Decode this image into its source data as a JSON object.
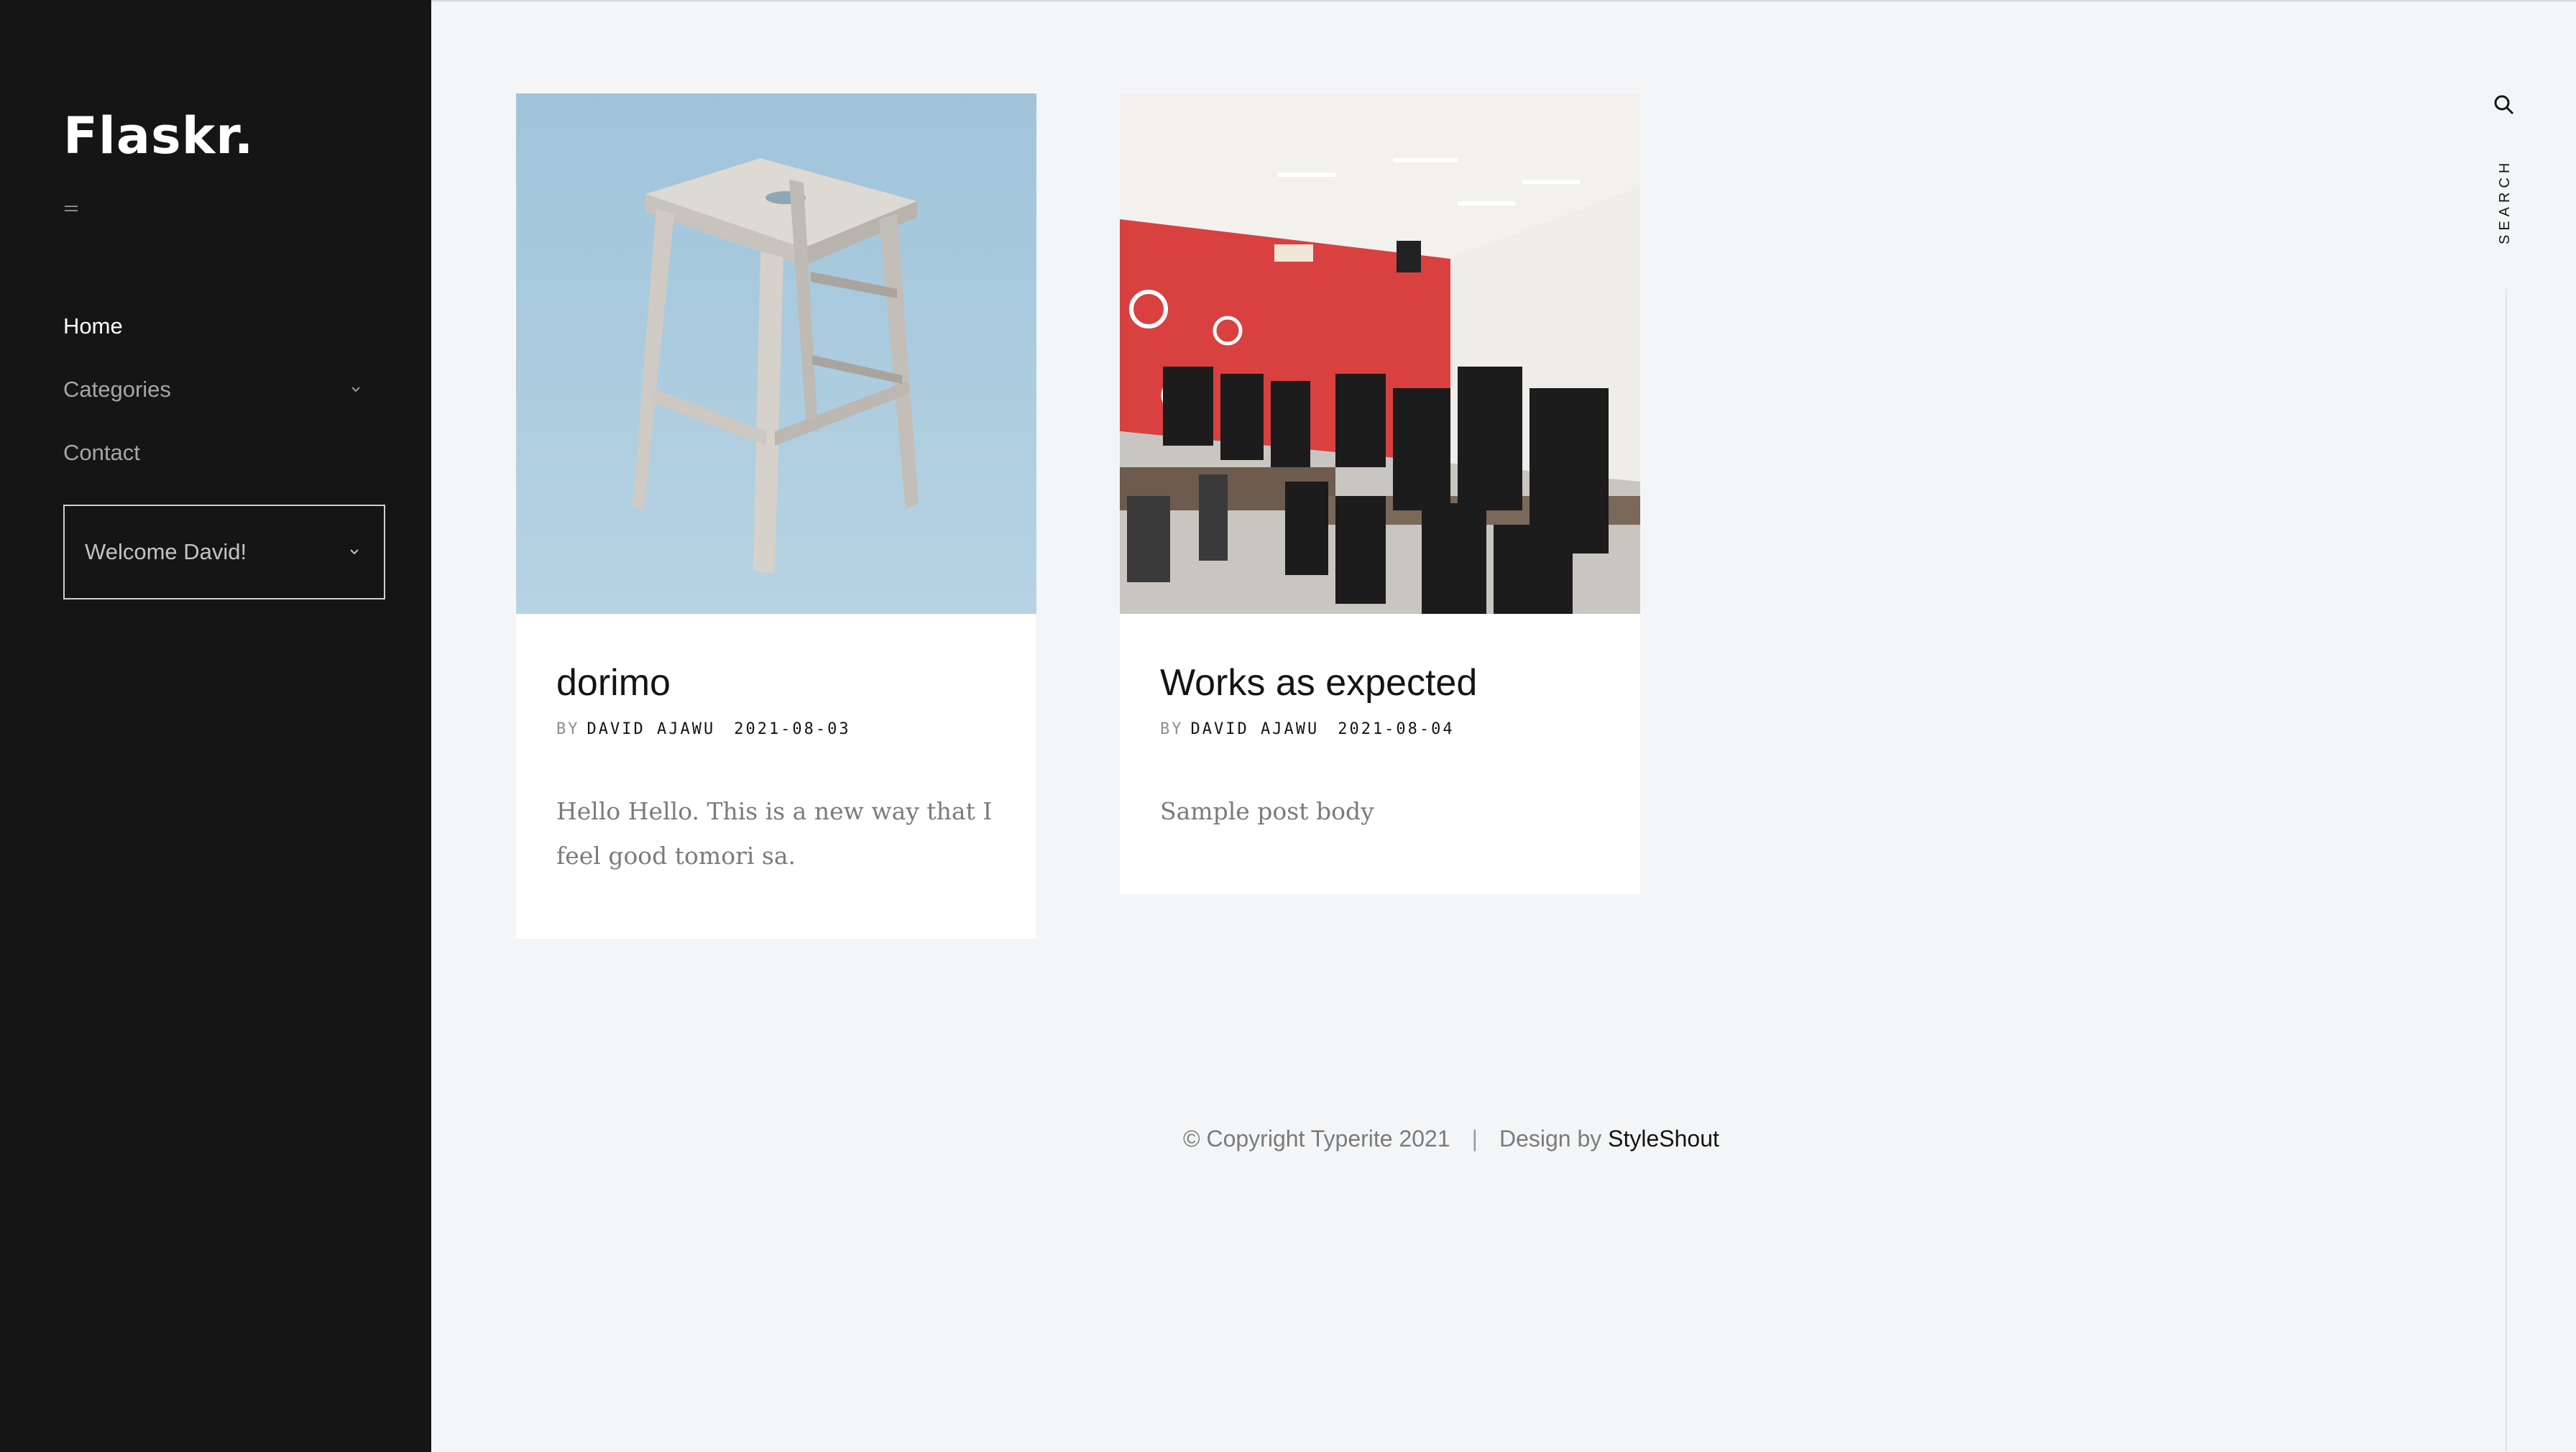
{
  "sidebar": {
    "logo": "Flaskr.",
    "nav": [
      {
        "label": "Home",
        "active": true
      },
      {
        "label": "Categories",
        "has_dropdown": true
      },
      {
        "label": "Contact"
      }
    ],
    "welcome": "Welcome David!"
  },
  "posts": [
    {
      "title": "dorimo",
      "by": "BY",
      "author": "DAVID AJAWU",
      "date": "2021-08-03",
      "excerpt": "Hello Hello. This is a new way that I feel good tomori sa."
    },
    {
      "title": "Works as expected",
      "by": "BY",
      "author": "DAVID AJAWU",
      "date": "2021-08-04",
      "excerpt": "Sample post body"
    }
  ],
  "footer": {
    "copyright": "© Copyright Typerite 2021",
    "separator": "|",
    "design_by": "Design by",
    "brand": "StyleShout"
  },
  "search": {
    "label": "SEARCH"
  },
  "colors": {
    "sidebar_bg": "#151515",
    "page_bg": "#f4f5f6",
    "card_bg": "#ffffff",
    "accent_red": "#d94040"
  }
}
